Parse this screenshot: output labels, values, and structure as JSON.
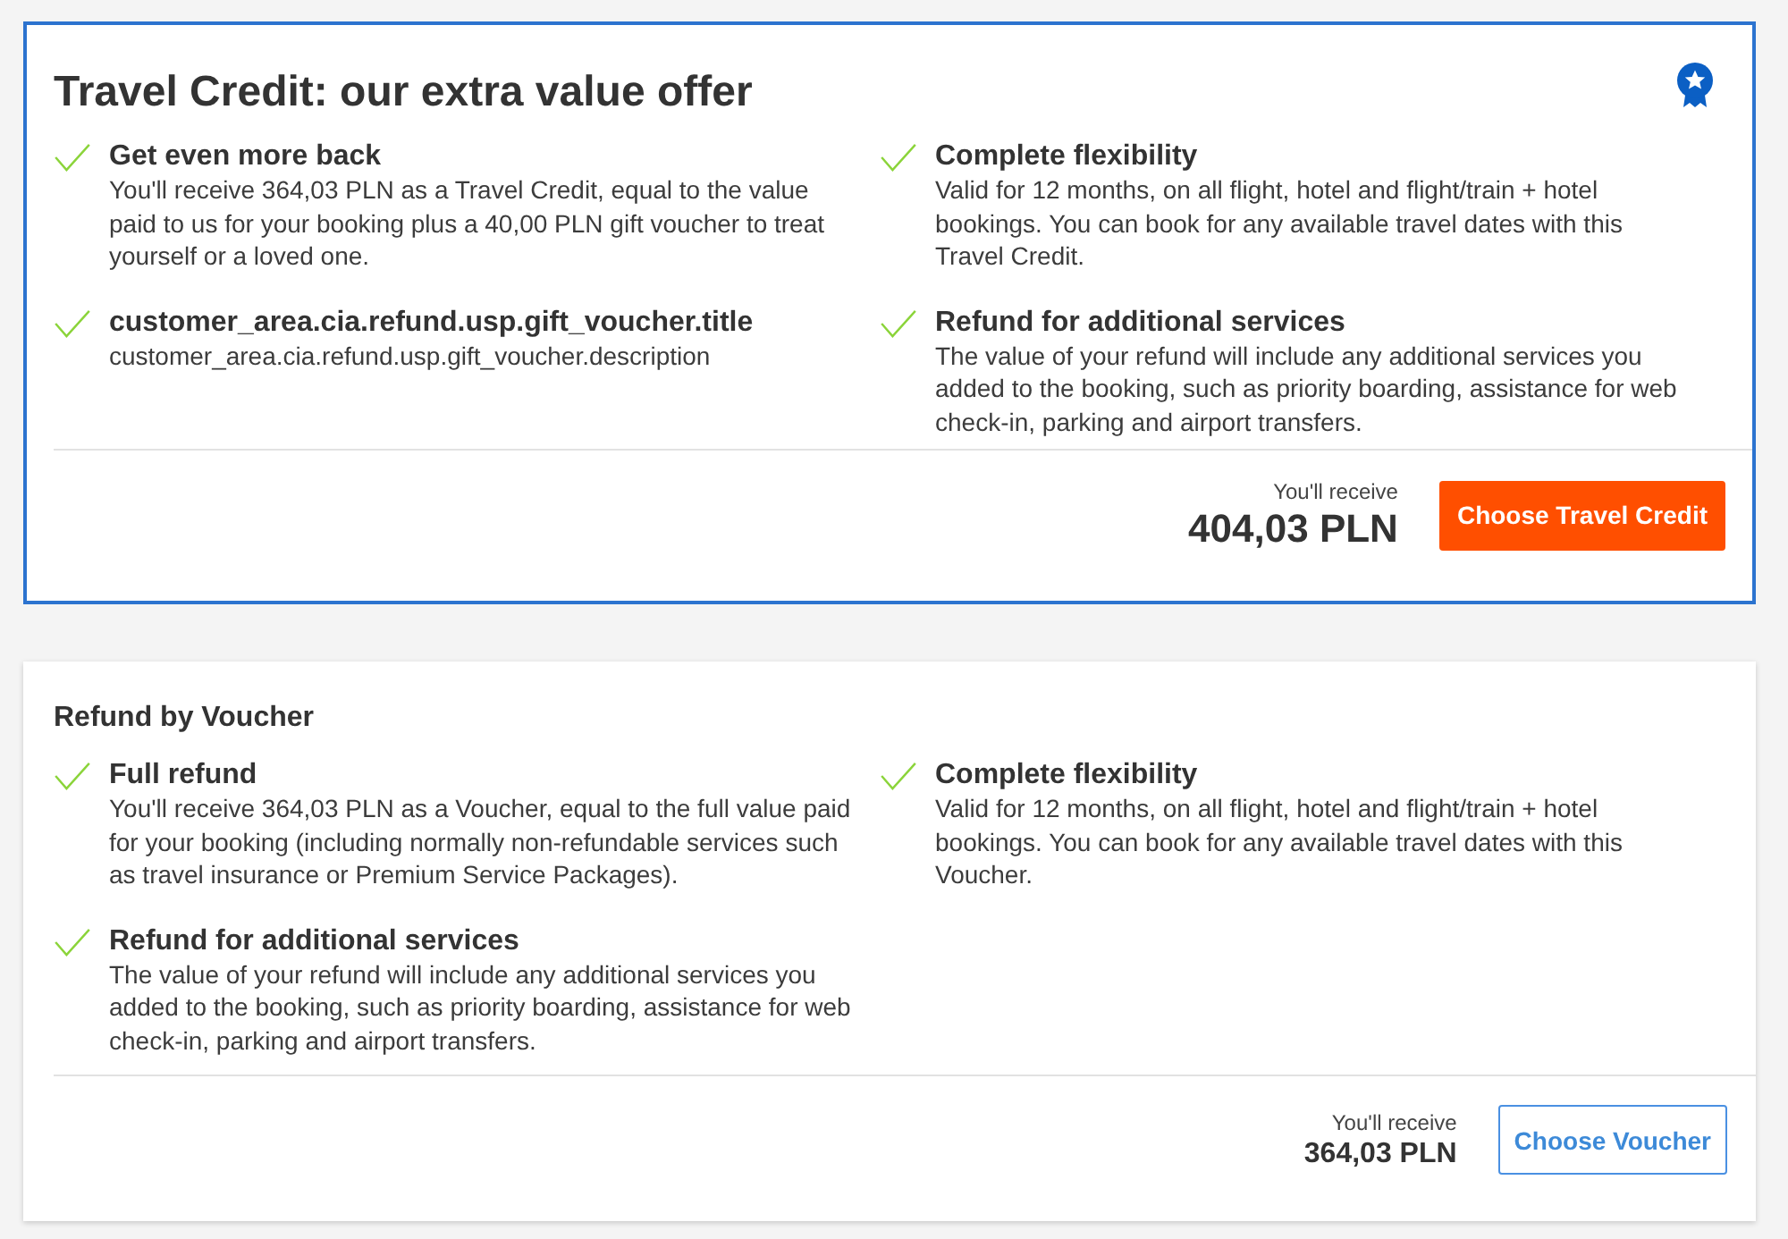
{
  "offers": [
    {
      "kind": "featured",
      "title": "Travel Credit: our extra value offer",
      "feature_columns": [
        {
          "features": [
            {
              "title": "Get even more back",
              "description": "You'll receive 364,03 PLN as a Travel Credit, equal to the value paid to us for your booking plus a 40,00 PLN gift voucher to treat yourself or a loved one."
            },
            {
              "title": "customer_area.cia.refund.usp.gift_voucher.title",
              "description": "customer_area.cia.refund.usp.gift_voucher.description"
            }
          ]
        },
        {
          "features": [
            {
              "title": "Complete flexibility",
              "description": "Valid for 12 months, on all flight, hotel and flight/train + hotel bookings. You can book for any available travel dates with this Travel Credit."
            },
            {
              "title": "Refund for additional services",
              "description": "The value of your refund will include any additional services you added to the booking, such as priority boarding, assistance for web check-in, parking and airport transfers."
            }
          ]
        }
      ],
      "receive_label": "You'll receive",
      "amount": "404,03 PLN",
      "button": "Choose Travel Credit"
    },
    {
      "kind": "standard",
      "title": "Refund by Voucher",
      "feature_columns": [
        {
          "features": [
            {
              "title": "Full refund",
              "description": "You'll receive 364,03 PLN as a Voucher, equal to the full value paid for your booking (including normally non-refundable services such as travel insurance or Premium Service Packages)."
            },
            {
              "title": "Refund for additional services",
              "description": "The value of your refund will include any additional services you added to the booking, such as priority boarding, assistance for web check-in, parking and airport transfers."
            }
          ]
        },
        {
          "features": [
            {
              "title": "Complete flexibility",
              "description": "Valid for 12 months, on all flight, hotel and flight/train + hotel bookings. You can book for any available travel dates with this Voucher."
            }
          ]
        }
      ],
      "receive_label": "You'll receive",
      "amount": "364,03 PLN",
      "button": "Choose Voucher"
    }
  ]
}
